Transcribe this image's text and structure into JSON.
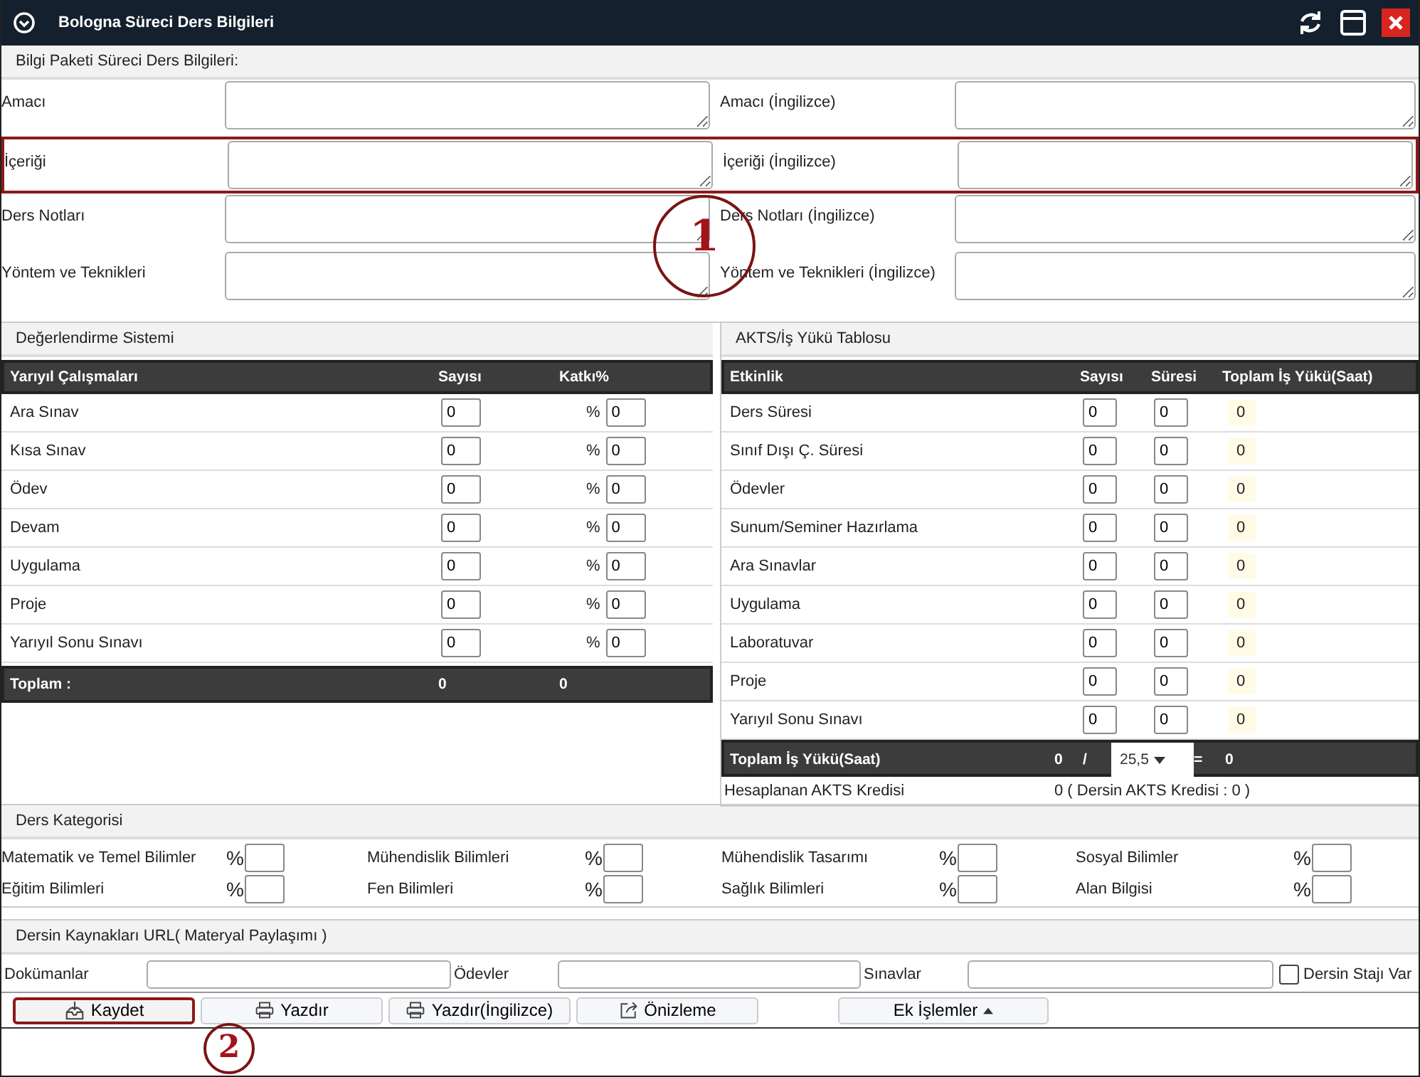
{
  "window": {
    "title": "Bologna Süreci Ders Bilgileri"
  },
  "info": {
    "title": "Bilgi Paketi Süreci Ders Bilgileri:",
    "rows": [
      {
        "left": "Amacı",
        "right": "Amacı (İngilizce)",
        "highlighted": false
      },
      {
        "left": "İçeriği",
        "right": "İçeriği (İngilizce)",
        "highlighted": true
      },
      {
        "left": "Ders Notları",
        "right": "Ders Notları (İngilizce)",
        "highlighted": false
      },
      {
        "left": "Yöntem ve Teknikleri",
        "right": "Yöntem ve Teknikleri (İngilizce)",
        "highlighted": false
      }
    ]
  },
  "evaluation": {
    "title": "Değerlendirme Sistemi",
    "columns": [
      "Yarıyıl Çalışmaları",
      "Sayısı",
      "Katkı%"
    ],
    "rows": [
      {
        "name": "Ara Sınav",
        "count": "0",
        "prefix": "%",
        "weight": "0"
      },
      {
        "name": "Kısa Sınav",
        "count": "0",
        "prefix": "%",
        "weight": "0"
      },
      {
        "name": "Ödev",
        "count": "0",
        "prefix": "%",
        "weight": "0"
      },
      {
        "name": "Devam",
        "count": "0",
        "prefix": "%",
        "weight": "0"
      },
      {
        "name": "Uygulama",
        "count": "0",
        "prefix": "%",
        "weight": "0"
      },
      {
        "name": "Proje",
        "count": "0",
        "prefix": "%",
        "weight": "0"
      },
      {
        "name": "Yarıyıl Sonu Sınavı",
        "count": "0",
        "prefix": "%",
        "weight": "0"
      }
    ],
    "total": {
      "label": "Toplam :",
      "count": "0",
      "weight": "0"
    }
  },
  "workload": {
    "title": "AKTS/İş Yükü Tablosu",
    "columns": [
      "Etkinlik",
      "Sayısı",
      "Süresi",
      "Toplam İş Yükü(Saat)"
    ],
    "rows": [
      {
        "name": "Ders Süresi",
        "count": "0",
        "duration": "0",
        "total": "0"
      },
      {
        "name": "Sınıf Dışı Ç. Süresi",
        "count": "0",
        "duration": "0",
        "total": "0"
      },
      {
        "name": "Ödevler",
        "count": "0",
        "duration": "0",
        "total": "0"
      },
      {
        "name": "Sunum/Seminer Hazırlama",
        "count": "0",
        "duration": "0",
        "total": "0"
      },
      {
        "name": "Ara Sınavlar",
        "count": "0",
        "duration": "0",
        "total": "0"
      },
      {
        "name": "Uygulama",
        "count": "0",
        "duration": "0",
        "total": "0"
      },
      {
        "name": "Laboratuvar",
        "count": "0",
        "duration": "0",
        "total": "0"
      },
      {
        "name": "Proje",
        "count": "0",
        "duration": "0",
        "total": "0"
      },
      {
        "name": "Yarıyıl Sonu Sınavı",
        "count": "0",
        "duration": "0",
        "total": "0"
      }
    ],
    "total": {
      "label": "Toplam İş Yükü(Saat)",
      "hours": "0",
      "divider": "/",
      "factor": "25,5",
      "equals": "=",
      "result": "0"
    },
    "credit": {
      "label": "Hesaplanan AKTS Kredisi",
      "value": "0 ( Dersin AKTS Kredisi : 0 )"
    }
  },
  "categories": {
    "title": "Ders Kategorisi",
    "items": [
      {
        "label": "Matematik ve Temel Bilimler",
        "prefix": "%"
      },
      {
        "label": "Mühendislik Bilimleri",
        "prefix": "%"
      },
      {
        "label": "Mühendislik Tasarımı",
        "prefix": "%"
      },
      {
        "label": "Sosyal Bilimler",
        "prefix": "%"
      },
      {
        "label": "Eğitim Bilimleri",
        "prefix": "%"
      },
      {
        "label": "Fen Bilimleri",
        "prefix": "%"
      },
      {
        "label": "Sağlık Bilimleri",
        "prefix": "%"
      },
      {
        "label": "Alan Bilgisi",
        "prefix": "%"
      }
    ]
  },
  "resources": {
    "title": "Dersin Kaynakları URL( Materyal Paylaşımı )",
    "fields": [
      {
        "label": "Dokümanlar"
      },
      {
        "label": "Ödevler"
      },
      {
        "label": "Sınavlar"
      }
    ],
    "checkbox": {
      "label": "Dersin Stajı Var",
      "checked": false
    }
  },
  "buttons": [
    {
      "label": "Kaydet",
      "kind": "save",
      "highlighted": true
    },
    {
      "label": "Yazdır",
      "kind": "print",
      "highlighted": false
    },
    {
      "label": "Yazdır(İngilizce)",
      "kind": "print",
      "highlighted": false
    },
    {
      "label": "Önizleme",
      "kind": "preview",
      "highlighted": false
    },
    {
      "label": "Ek İşlemler",
      "kind": "menu",
      "highlighted": false
    }
  ],
  "callouts": [
    {
      "number": "1"
    },
    {
      "number": "2"
    }
  ]
}
